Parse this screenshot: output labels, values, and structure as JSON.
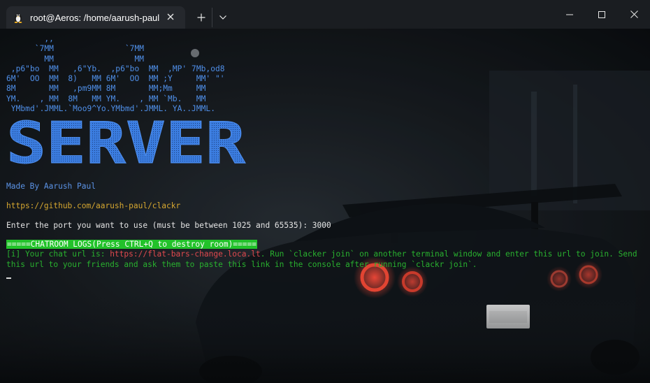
{
  "window": {
    "tab_title": "root@Aeros: /home/aarush-paul",
    "tab_icon": "linux-tux-icon"
  },
  "terminal": {
    "ascii_art": "        ,,\n      `7MM               `7MM\n        MM                 MM\n ,p6\"bo  MM   ,6\"Yb.  ,p6\"bo  MM  ,MP' 7Mb,od8\n6M'  OO  MM  8)   MM 6M'  OO  MM ;Y     MM' \"'\n8M       MM   ,pm9MM 8M       MM;Mm     MM\nYM.    , MM  8M   MM YM.    , MM `Mb.   MM\n YMbmd'.JMML.`Moo9^Yo.YMbmd'.JMML. YA..JMML.",
    "banner_text": "SERVER",
    "made_by": "Made By Aarush Paul",
    "github": "https://github.com/aarush-paul/clackr",
    "port_prompt": "Enter the port you want to use (must be between 1025 and 65535): 3000",
    "logs_header": "=====CHATROOM LOGS(Press CTRL+Q to destroy room)=====",
    "chat_prefix": "[i] Your chat url is:  ",
    "chat_url": "https://flat-bars-change.loca.lt",
    "chat_suffix": ". Run `clacker join` on another terminal window and enter this url to join. Send this url to your friends and ask them to paste this link in the console after running `clackr join`."
  },
  "colors": {
    "ascii": "#4f8fe8",
    "made_by": "#5b93e6",
    "github": "#d6a730",
    "logs_bg": "#22c22a",
    "chat": "#29b12f",
    "url": "#e0494e"
  }
}
